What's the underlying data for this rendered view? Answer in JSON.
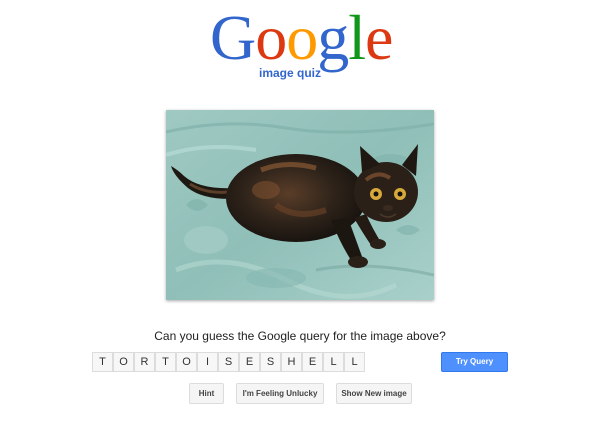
{
  "logo": {
    "letters": [
      {
        "char": "G",
        "color": "#3366cc"
      },
      {
        "char": "o",
        "color": "#dc3912"
      },
      {
        "char": "o",
        "color": "#ff9900"
      },
      {
        "char": "g",
        "color": "#3366cc"
      },
      {
        "char": "l",
        "color": "#109618"
      },
      {
        "char": "e",
        "color": "#dc3912"
      }
    ],
    "subtitle": "image quiz"
  },
  "photo": {
    "icon": "tortoiseshell-cat-photo",
    "colors": {
      "cushion": "#8fbfb8",
      "cat": "#2a2119"
    }
  },
  "quiz": {
    "question": "Can you guess the Google query for the image above?",
    "answer_letters": [
      "T",
      "O",
      "R",
      "T",
      "O",
      "I",
      "S",
      "E",
      "S",
      "H",
      "E",
      "L",
      "L"
    ],
    "try_label": "Try Query",
    "accent": "#4d90fe"
  },
  "actions": {
    "hint_label": "Hint",
    "unlucky_label": "I'm Feeling Unlucky",
    "new_image_label": "Show New image"
  }
}
